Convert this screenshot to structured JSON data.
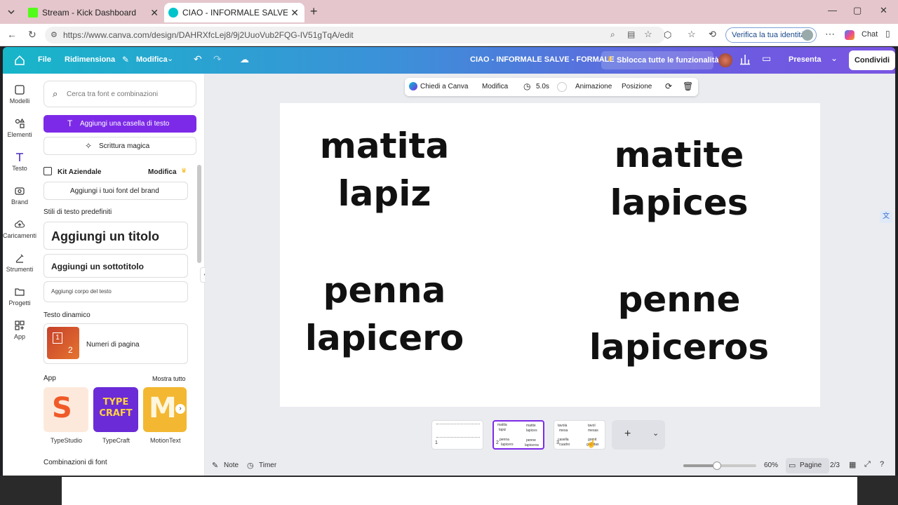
{
  "browser": {
    "tabs": [
      {
        "title": "Stream - Kick Dashboard"
      },
      {
        "title": "CIAO - INFORMALE SALVE - FORM"
      }
    ],
    "url": "https://www.canva.com/design/DAHRXfcLej8/9j2UuoVub2FQG-IV51gTqA/edit",
    "verify_label": "Verifica la tua identità",
    "chat_label": "Chat"
  },
  "canva_bar": {
    "file": "File",
    "resize": "Ridimensiona",
    "edit": "Modifica",
    "design_title": "CIAO - INFORMALE SALVE - FORMALE",
    "unlock": "Sblocca tutte le funzionalità",
    "present": "Presenta",
    "share": "Condividi"
  },
  "rail": [
    "Modelli",
    "Elementi",
    "Testo",
    "Brand",
    "Caricamenti",
    "Strumenti",
    "Progetti",
    "App"
  ],
  "panel": {
    "search_placeholder": "Cerca tra font e combinazioni",
    "add_textbox": "Aggiungi una casella di testo",
    "magic_write": "Scrittura magica",
    "brand_kit": "Kit Aziendale",
    "brand_edit": "Modifica",
    "add_brand_fonts": "Aggiungi i tuoi font del brand",
    "default_styles": "Stili di testo predefiniti",
    "add_title": "Aggiungi un titolo",
    "add_subtitle": "Aggiungi un sottotitolo",
    "add_body": "Aggiungi corpo del testo",
    "dynamic_text": "Testo dinamico",
    "page_numbers": "Numeri di pagina",
    "app_heading": "App",
    "show_all": "Mostra tutto",
    "apps": [
      {
        "name": "TypeStudio",
        "color": "#f05a28"
      },
      {
        "name": "TypeCraft",
        "color": "#6b2bd6"
      },
      {
        "name": "MotionText",
        "color": "#f3b732"
      }
    ],
    "font_combos": "Combinazioni di font"
  },
  "context_toolbar": {
    "ask_canva": "Chiedi a Canva",
    "edit": "Modifica",
    "duration": "5.0s",
    "animation": "Animazione",
    "position": "Posizione"
  },
  "slide": {
    "top_left": [
      "matita",
      "lapiz"
    ],
    "top_right": [
      "matite",
      "lapices"
    ],
    "bottom_left": [
      "penna",
      "lapicero"
    ],
    "bottom_right": [
      "penne",
      "lapiceros"
    ]
  },
  "thumbnails": [
    {
      "number": "1",
      "lines": [
        "",
        ""
      ]
    },
    {
      "number": "2",
      "lines": [
        "matita",
        "lapiz",
        "matite",
        "lapices",
        "penna",
        "lapicero",
        "penne",
        "lapiceros"
      ]
    },
    {
      "number": "3",
      "lines": [
        "tavola",
        "mesa",
        "tavol",
        "mesas",
        "casella",
        "cuadro",
        "gomit",
        "gomitas"
      ]
    }
  ],
  "footer": {
    "notes": "Note",
    "timer": "Timer",
    "zoom": "60%",
    "pages": "Pagine",
    "page_count": "2/3"
  },
  "colors": {
    "accent": "#7d2ae8",
    "bar_start": "#17b6c9",
    "bar_end": "#7a55e3"
  }
}
